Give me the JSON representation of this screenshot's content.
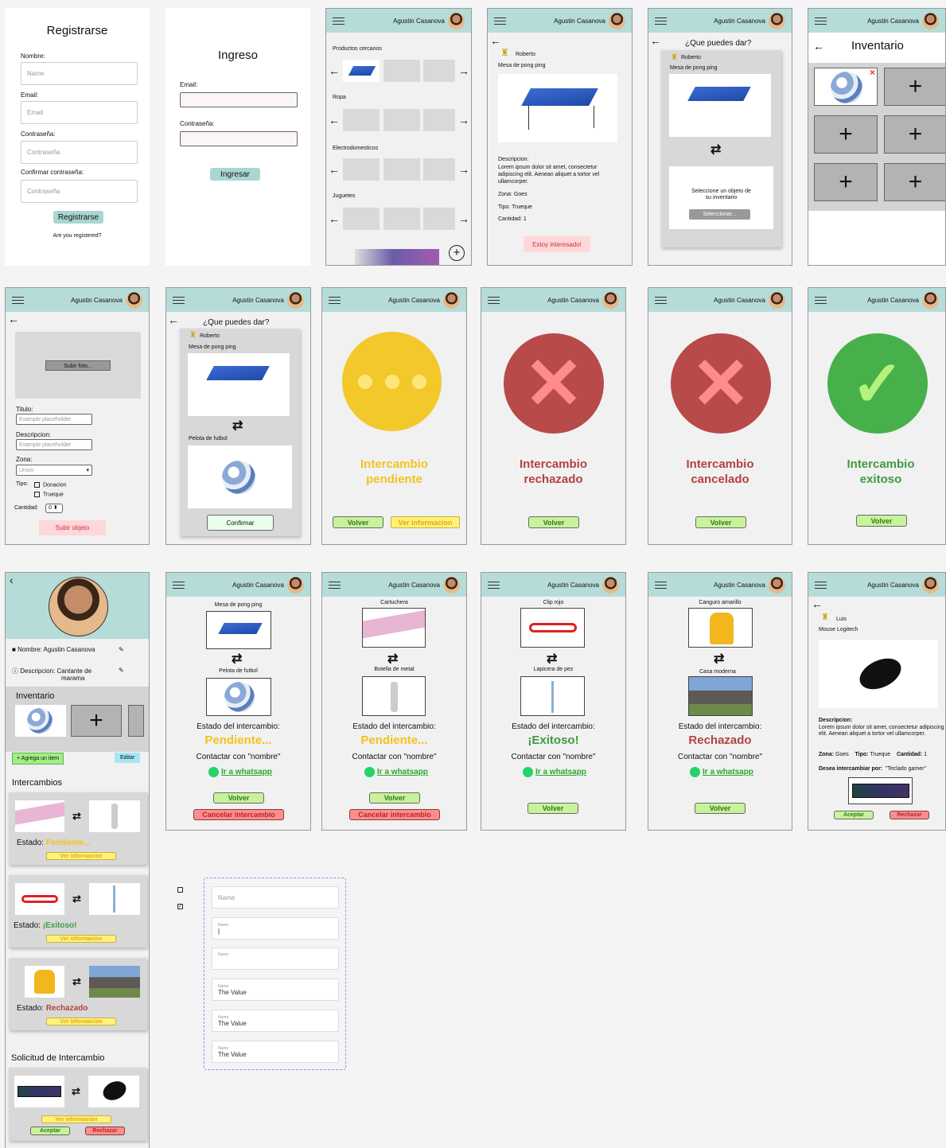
{
  "user_name": "Agustin Casanova",
  "register": {
    "title": "Registrarse",
    "name_label": "Nombre:",
    "name_ph": "Name",
    "email_label": "Email:",
    "email_ph": "Email",
    "pass_label": "Contraseña:",
    "pass_ph": "Contraseña",
    "confirm_label": "Confirmar contraseña:",
    "confirm_ph": "Contraseña",
    "button": "Registrarse",
    "registered": "Are you registered?"
  },
  "login": {
    "title": "Ingreso",
    "email_label": "Email:",
    "pass_label": "Contraseña:",
    "button": "Ingresar"
  },
  "home": {
    "section1": "Productos cercanos",
    "section2": "Ropa",
    "section3": "Electrodomesticos",
    "section4": "Juguetes",
    "add_icon": "plus-circle-icon"
  },
  "product": {
    "owner": "Roberto",
    "name": "Mesa de pong ping",
    "desc_title": "Descripcion:",
    "desc": "Lorem ipsum dolor sit amet, consectetur adipiscing elit. Aenean aliquet a tortor vel ullamcorper.",
    "zone": "Zona: Goes",
    "type": "Tipo: Trueque",
    "qty": "Cantidad: 1",
    "button": "Estoy interesado!"
  },
  "offer": {
    "title": "¿Que puedes dar?",
    "owner": "Roberto",
    "product": "Mesa de pong ping",
    "select_text1": "Seleccione un objeto de",
    "select_text2": "su inventario",
    "select_button": "Seleccionar..."
  },
  "inventory": {
    "title": "Inventario"
  },
  "upload": {
    "photo_button": "Subir foto...",
    "title_label": "Titulo:",
    "title_ph": "Example placeholder",
    "desc_label": "Descripcion:",
    "desc_ph": "Example placeholder",
    "zone_label": "Zona:",
    "zone_value": "Union",
    "type_label": "Tipo:",
    "type_opt1": "Donacion",
    "type_opt2": "Trueque",
    "qty_label": "Cantidad:",
    "qty_value": "0",
    "submit": "Subir objeto"
  },
  "offer2": {
    "title": "¿Que puedes dar?",
    "owner": "Roberto",
    "product": "Mesa de pong ping",
    "my_item": "Pelota de futbol",
    "confirm": "Confirmar"
  },
  "status": {
    "pending": {
      "l1": "Intercambio",
      "l2": "pendiente",
      "back": "Volver",
      "info": "Ver informacion"
    },
    "rejected": {
      "l1": "Intercambio",
      "l2": "rechazado",
      "back": "Volver"
    },
    "cancelled": {
      "l1": "Intercambio",
      "l2": "cancelado",
      "back": "Volver"
    },
    "success": {
      "l1": "Intercambio",
      "l2": "exitoso",
      "back": "Volver"
    }
  },
  "profile": {
    "name": "Nombre: Agustin Casanova",
    "desc1": "Descripcion: Cantante de",
    "desc2": "marama",
    "inventory": "Inventario",
    "add_item": "+ Agrega un item",
    "edit": "Editar",
    "exchanges": "Intercambios",
    "estado": "Estado:",
    "st1": "Pendiente...",
    "st2": "¡Exitoso!",
    "st3": "Rechazado",
    "info": "Ver informacion",
    "request_title": "Solicitud de Intercambio",
    "accept": "Aceptar",
    "reject": "Rechazar"
  },
  "exchanges": [
    {
      "item1": "Mesa de pong ping",
      "item2": "Pelota de futbol",
      "state_label": "Estado del intercambio:",
      "state": "Pendiente...",
      "contact": "Contactar con \"nombre\"",
      "wa": "Ir a whatsapp",
      "back": "Volver",
      "cancel": "Cancelar intercambio"
    },
    {
      "item1": "Cartuchera",
      "item2": "Botella de metal",
      "state_label": "Estado del intercambio:",
      "state": "Pendiente...",
      "contact": "Contactar con \"nombre\"",
      "wa": "Ir a whatsapp",
      "back": "Volver",
      "cancel": "Cancelar intercambio"
    },
    {
      "item1": "Clip rojo",
      "item2": "Lapicera de pez",
      "state_label": "Estado del intercambio:",
      "state": "¡Exitoso!",
      "contact": "Contactar con \"nombre\"",
      "wa": "Ir a whatsapp",
      "back": "Volver"
    },
    {
      "item1": "Canguro amarillo",
      "item2": "Casa moderna",
      "state_label": "Estado del intercambio:",
      "state": "Rechazado",
      "contact": "Contactar con \"nombre\"",
      "wa": "Ir a whatsapp",
      "back": "Volver"
    }
  ],
  "request": {
    "owner": "Luis",
    "product": "Mouse Logitech",
    "desc_title": "Descripcion:",
    "desc": "Lorem ipsum dolor sit amet, consectetur adipiscing elit. Aenean aliquet a tortor vel ullamcorper.",
    "zone_label": "Zona:",
    "zone": "Goes",
    "type_label": "Tipo:",
    "type": "Trueque",
    "qty_label": "Cantidad:",
    "qty": "1",
    "wants_label": "Desea intercambiar por:",
    "wants": "\"Teclado gamer\"",
    "accept": "Aceptar",
    "reject": "Rechazar"
  },
  "form_states": {
    "f1": "Name",
    "f2_label": "Name",
    "f3_label": "Name",
    "f4_label": "Name",
    "f4_value": "The Value",
    "f5_label": "Name",
    "f5_value": "The Value",
    "f6_label": "Name",
    "f6_value": "The Value"
  }
}
